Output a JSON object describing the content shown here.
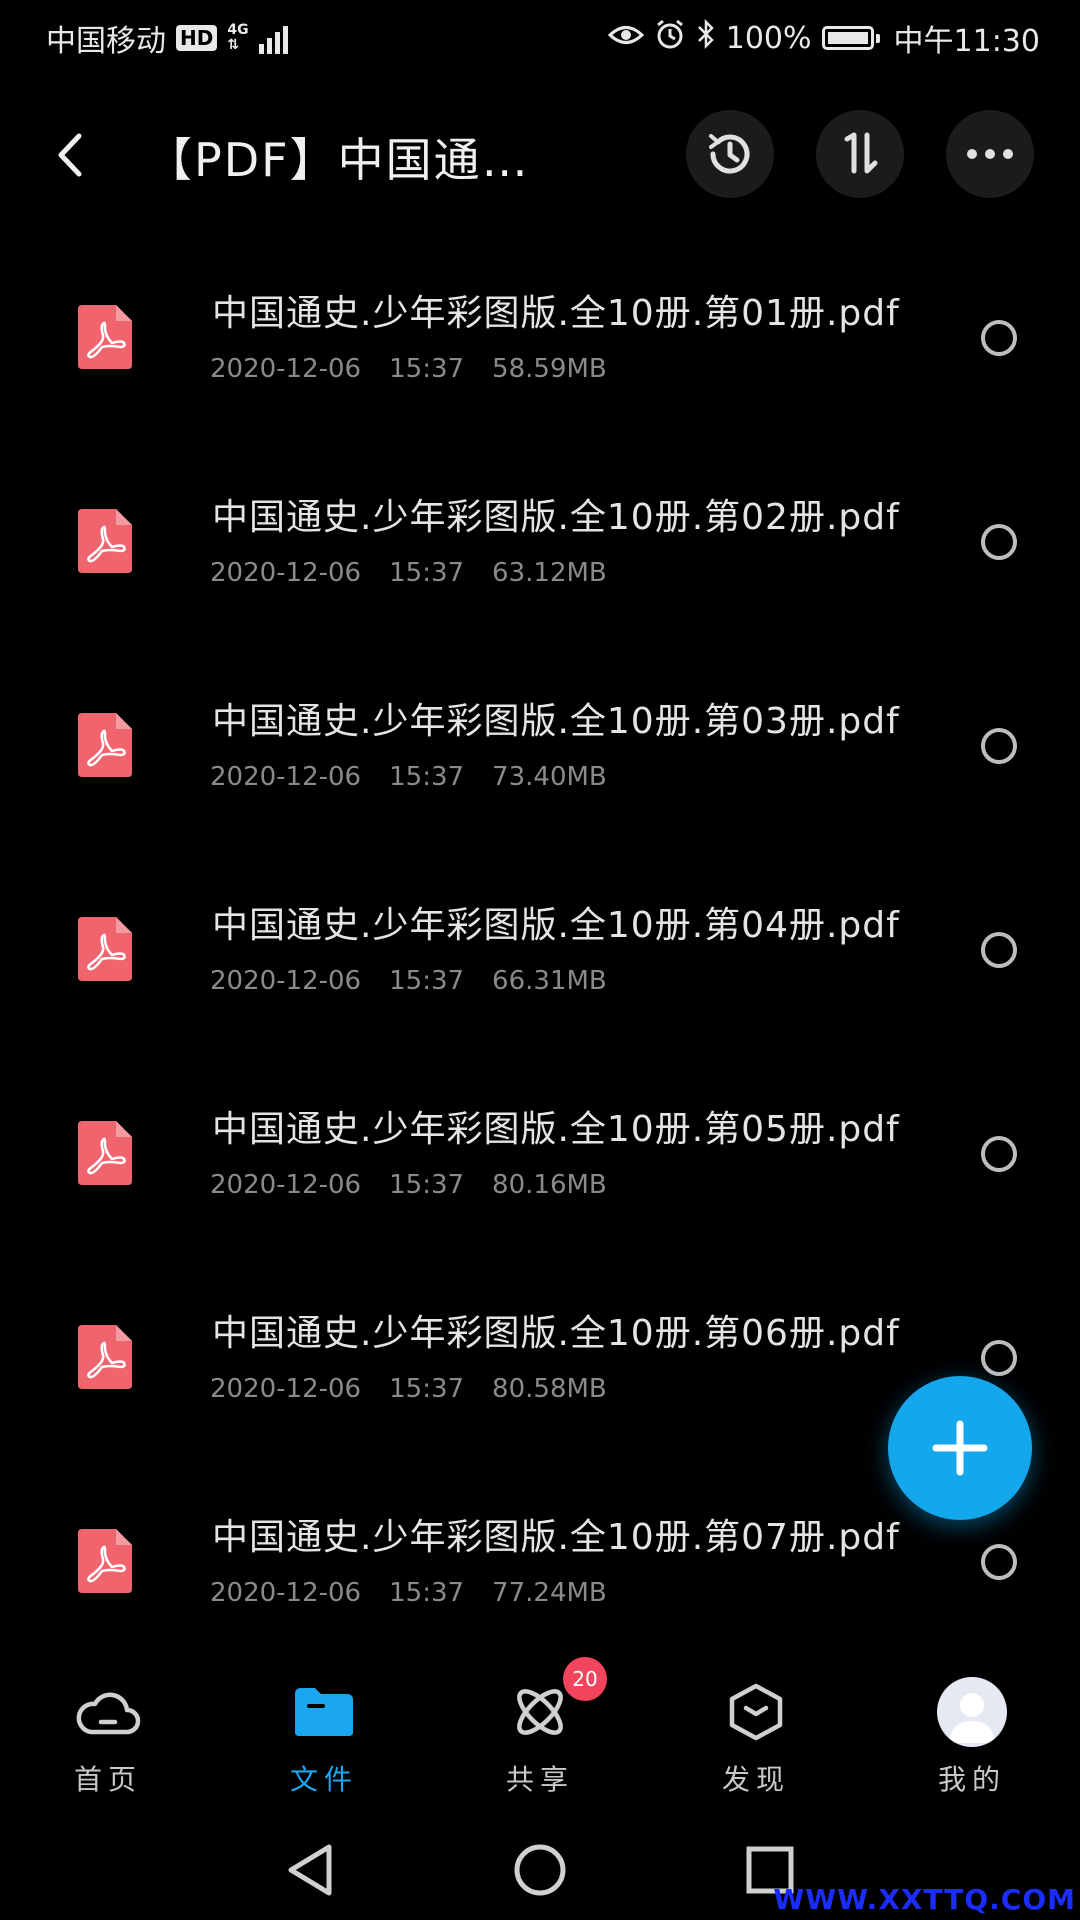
{
  "status_bar": {
    "carrier": "中国移动",
    "hd": "HD",
    "network": "4G",
    "battery": "100%",
    "time": "中午11:30"
  },
  "header": {
    "title": "【PDF】中国通史…",
    "icons": [
      "back-arrow-icon",
      "history-icon",
      "sort-icon",
      "more-icon"
    ]
  },
  "files": [
    {
      "name": "中国通史.少年彩图版.全10册.第01册.pdf",
      "date": "2020-12-06",
      "time": "15:37",
      "size": "58.59MB"
    },
    {
      "name": "中国通史.少年彩图版.全10册.第02册.pdf",
      "date": "2020-12-06",
      "time": "15:37",
      "size": "63.12MB"
    },
    {
      "name": "中国通史.少年彩图版.全10册.第03册.pdf",
      "date": "2020-12-06",
      "time": "15:37",
      "size": "73.40MB"
    },
    {
      "name": "中国通史.少年彩图版.全10册.第04册.pdf",
      "date": "2020-12-06",
      "time": "15:37",
      "size": "66.31MB"
    },
    {
      "name": "中国通史.少年彩图版.全10册.第05册.pdf",
      "date": "2020-12-06",
      "time": "15:37",
      "size": "80.16MB"
    },
    {
      "name": "中国通史.少年彩图版.全10册.第06册.pdf",
      "date": "2020-12-06",
      "time": "15:37",
      "size": "80.58MB"
    },
    {
      "name": "中国通史.少年彩图版.全10册.第07册.pdf",
      "date": "2020-12-06",
      "time": "15:37",
      "size": "77.24MB"
    }
  ],
  "bottom_nav": {
    "items": [
      {
        "label": "首页",
        "icon": "cloud-icon"
      },
      {
        "label": "文件",
        "icon": "folder-icon"
      },
      {
        "label": "共享",
        "icon": "atom-icon"
      },
      {
        "label": "发现",
        "icon": "cube-icon"
      },
      {
        "label": "我的",
        "icon": "avatar-icon"
      }
    ],
    "share_badge": "20"
  },
  "colors": {
    "accent": "#1aa6f0",
    "pdf_red": "#f0646e",
    "badge_red": "#f2445c"
  },
  "watermark": "WWW.XXTTQ.COM"
}
